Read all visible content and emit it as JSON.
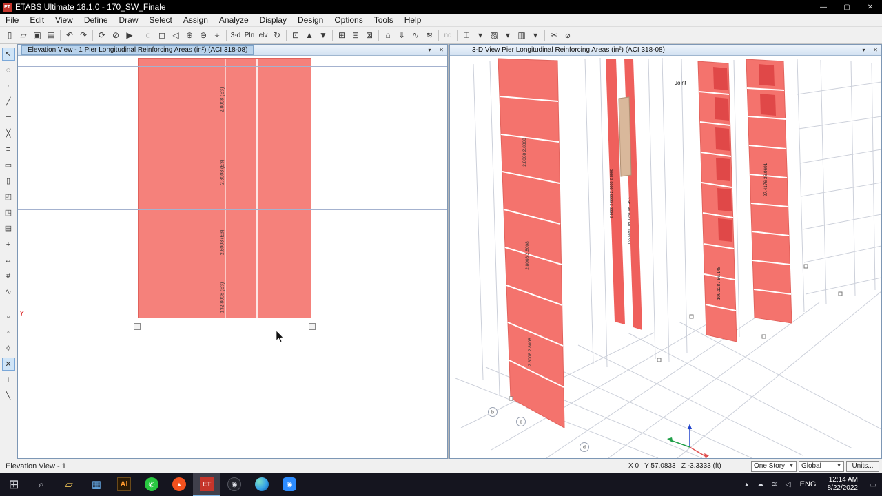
{
  "colors": {
    "wall_fill": "#f5817b",
    "wall_edge": "#e2625c",
    "grid_line": "#a4b2cf",
    "active_tab": "#b9d3ec",
    "taskbar_bg": "#15151f",
    "etabs_red": "#c5352b"
  },
  "titlebar": {
    "app_initials": "ET",
    "title": "ETABS Ultimate 18.1.0 - 170_SW_Finale",
    "minimize": "—",
    "maximize": "▢",
    "close": "✕"
  },
  "menu": {
    "items": [
      {
        "name": "menu-file",
        "label": "File"
      },
      {
        "name": "menu-edit",
        "label": "Edit"
      },
      {
        "name": "menu-view",
        "label": "View"
      },
      {
        "name": "menu-define",
        "label": "Define"
      },
      {
        "name": "menu-draw",
        "label": "Draw"
      },
      {
        "name": "menu-select",
        "label": "Select"
      },
      {
        "name": "menu-assign",
        "label": "Assign"
      },
      {
        "name": "menu-analyze",
        "label": "Analyze"
      },
      {
        "name": "menu-display",
        "label": "Display"
      },
      {
        "name": "menu-design",
        "label": "Design"
      },
      {
        "name": "menu-options",
        "label": "Options"
      },
      {
        "name": "menu-tools",
        "label": "Tools"
      },
      {
        "name": "menu-help",
        "label": "Help"
      }
    ]
  },
  "toolbar": {
    "items": [
      {
        "name": "new-model-icon",
        "glyph": "▯"
      },
      {
        "name": "open-file-icon",
        "glyph": "▱"
      },
      {
        "name": "save-model-icon",
        "glyph": "▣"
      },
      {
        "name": "print-icon",
        "glyph": "▤"
      },
      {
        "sep": true
      },
      {
        "name": "undo-icon",
        "glyph": "↶"
      },
      {
        "name": "redo-icon",
        "glyph": "↷"
      },
      {
        "sep": true
      },
      {
        "name": "refresh-window-icon",
        "glyph": "⟳"
      },
      {
        "name": "lock-model-icon",
        "glyph": "⊘"
      },
      {
        "name": "run-analysis-icon",
        "glyph": "▶"
      },
      {
        "sep": true
      },
      {
        "name": "rubber-band-zoom-icon",
        "glyph": "◌"
      },
      {
        "name": "restore-full-view-icon",
        "glyph": "◻"
      },
      {
        "name": "previous-zoom-icon",
        "glyph": "◁"
      },
      {
        "name": "zoom-in-icon",
        "glyph": "⊕"
      },
      {
        "name": "zoom-out-icon",
        "glyph": "⊖"
      },
      {
        "name": "pan-icon",
        "glyph": "⌖"
      },
      {
        "sep": true
      },
      {
        "name": "view-3d-button",
        "glyph": "3-d",
        "text": true
      },
      {
        "name": "view-plan-button",
        "glyph": "Pln",
        "text": true
      },
      {
        "name": "view-elevation-button",
        "glyph": "elv",
        "text": true
      },
      {
        "name": "rotate-3d-view-icon",
        "glyph": "↻"
      },
      {
        "sep": true
      },
      {
        "name": "object-shrink-icon",
        "glyph": "⊡"
      },
      {
        "name": "up-one-story-icon",
        "glyph": "▲"
      },
      {
        "name": "down-one-story-icon",
        "glyph": "▼"
      },
      {
        "sep": true
      },
      {
        "name": "view-limits-icon",
        "glyph": "⊞"
      },
      {
        "name": "grid-visibility-icon",
        "glyph": "⊟"
      },
      {
        "name": "object-visibility-icon",
        "glyph": "⊠"
      },
      {
        "sep": true
      },
      {
        "name": "show-undeformed-icon",
        "glyph": "⌂"
      },
      {
        "name": "show-loads-icon",
        "glyph": "⇓"
      },
      {
        "name": "show-deformed-icon",
        "glyph": "∿"
      },
      {
        "name": "show-forces-icon",
        "glyph": "≋"
      },
      {
        "sep": true
      },
      {
        "name": "node-label-toggle",
        "glyph": "nd",
        "text": true,
        "grayed": true
      },
      {
        "sep": true
      },
      {
        "name": "frame-section-icon",
        "glyph": "⌶"
      },
      {
        "name": "frame-section-dropdown-icon",
        "glyph": "▾"
      },
      {
        "name": "area-section-icon",
        "glyph": "▨"
      },
      {
        "name": "area-section-dropdown-icon",
        "glyph": "▾"
      },
      {
        "name": "wall-section-icon",
        "glyph": "▥"
      },
      {
        "name": "wall-section-dropdown-icon",
        "glyph": "▾"
      },
      {
        "sep": true
      },
      {
        "name": "section-cut-icon",
        "glyph": "✂"
      },
      {
        "name": "measure-icon",
        "glyph": "⌀"
      }
    ]
  },
  "side_toolbar": {
    "items": [
      {
        "name": "select-arrow-icon",
        "glyph": "↖",
        "active": true
      },
      {
        "name": "select-poly-icon",
        "glyph": "◌"
      },
      {
        "name": "draw-joint-icon",
        "glyph": "·"
      },
      {
        "name": "draw-frame-icon",
        "glyph": "╱"
      },
      {
        "name": "quick-draw-frame-icon",
        "glyph": "═"
      },
      {
        "name": "quick-draw-braces-icon",
        "glyph": "╳"
      },
      {
        "name": "quick-draw-secondary-beams-icon",
        "glyph": "≡"
      },
      {
        "name": "draw-floor-icon",
        "glyph": "▭"
      },
      {
        "name": "draw-wall-icon",
        "glyph": "▯"
      },
      {
        "name": "quick-draw-floor-icon",
        "glyph": "◰"
      },
      {
        "name": "quick-draw-wall-icon",
        "glyph": "◳"
      },
      {
        "name": "draw-rect-floor-icon",
        "glyph": "▤"
      },
      {
        "name": "draw-reference-point-icon",
        "glyph": "+"
      },
      {
        "name": "draw-dimension-icon",
        "glyph": "↔"
      },
      {
        "name": "draw-grid-icon",
        "glyph": "#"
      },
      {
        "name": "draw-link-icon",
        "glyph": "∿"
      },
      {
        "sep": true
      },
      {
        "name": "snap-to-grid-icon",
        "glyph": "▫"
      },
      {
        "name": "snap-to-joints-icon",
        "glyph": "◦"
      },
      {
        "name": "snap-to-midpoints-icon",
        "glyph": "◊"
      },
      {
        "name": "snap-to-intersections-icon",
        "glyph": "✕",
        "active": true
      },
      {
        "name": "snap-to-perpendicular-icon",
        "glyph": "⊥"
      },
      {
        "name": "snap-to-lines-icon",
        "glyph": "╲"
      }
    ]
  },
  "left_window": {
    "title": "Elevation View - 1  Pier Longitudinal Reinforcing Areas (in²)  (ACI 318-08)",
    "axis_label": "Y",
    "labels": [
      "2.8008 (E3)",
      "2.8008 (E3)",
      "2.8008 (E3)",
      "132.8008 (E3)"
    ],
    "dropdown_glyph": "▾",
    "close_glyph": "✕"
  },
  "right_window": {
    "title": "3-D View  Pier Longitudinal Reinforcing Areas (in²)  (ACI 318-08)",
    "joint_label": "Joint",
    "labels": [
      "2.8008 2.8008",
      "2.8008 2.8008",
      "2.8008 2.8008",
      "2.8008 2.8008 2.8008 2.8008",
      "156.1481 109.1287 98.1493",
      "109.1287 56.148",
      "27.4176 36.0691"
    ],
    "grid_bubbles": [
      "b",
      "c",
      "d"
    ],
    "dropdown_glyph": "▾",
    "close_glyph": "✕"
  },
  "statusbar": {
    "view_name": "Elevation View - 1",
    "coordinates": "X 0   Y 57.0833   Z -3.3333 (ft)",
    "story": "One Story",
    "csys": "Global",
    "units": "Units..."
  },
  "taskbar": {
    "apps": [
      {
        "name": "start-button",
        "glyph": "⊞"
      },
      {
        "name": "search-button",
        "glyph": "⌕"
      },
      {
        "name": "file-explorer-button",
        "glyph": "▱"
      },
      {
        "name": "photos-button",
        "glyph": "▦"
      },
      {
        "name": "illustrator-button",
        "glyph": "Ai"
      },
      {
        "name": "whatsapp-button",
        "glyph": "✆"
      },
      {
        "name": "brave-button",
        "glyph": "▲"
      },
      {
        "name": "etabs-button",
        "glyph": "ET",
        "active": true
      },
      {
        "name": "obs-button",
        "glyph": "◉"
      },
      {
        "name": "edge-button",
        "glyph": ""
      },
      {
        "name": "camera-button",
        "glyph": "◉"
      }
    ],
    "tray": [
      {
        "name": "tray-expand-icon",
        "glyph": "▴"
      },
      {
        "name": "onedrive-icon",
        "glyph": "☁"
      },
      {
        "name": "network-icon",
        "glyph": "≋"
      },
      {
        "name": "volume-icon",
        "glyph": "◁"
      }
    ],
    "language": "ENG",
    "time": "12:14 AM",
    "date": "8/22/2022",
    "action_center_glyph": "▭"
  }
}
